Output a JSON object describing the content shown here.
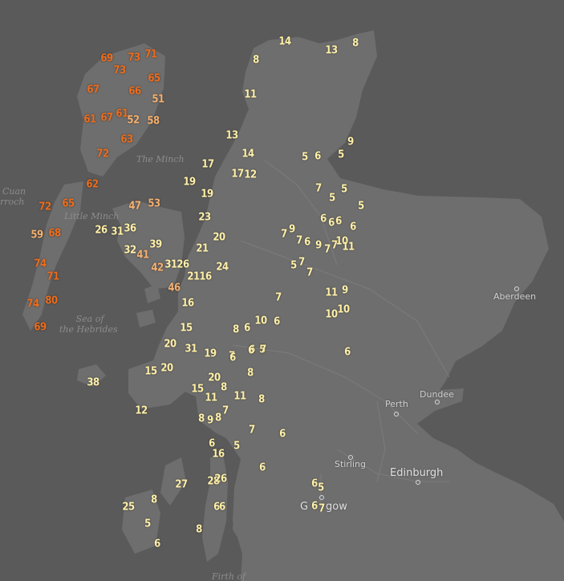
{
  "map": {
    "colors": {
      "sea": "#5a5a5a",
      "land": "#6e6e6e",
      "low": "#fff0a8",
      "mid": "#f5b070",
      "high": "#ee6c1c"
    },
    "water_labels": {
      "minch": "The Minch",
      "little_minch": "Little Minch",
      "sea_hebrides_1": "Sea of",
      "sea_hebrides_2": "the Hebrides",
      "cuan_1": "Cuan",
      "cuan_2": "rroch",
      "firth": "Firth of"
    },
    "places": {
      "aberdeen": "Aberdeen",
      "dundee": "Dundee",
      "perth": "Perth",
      "stirling": "Stirling",
      "edinburgh": "Edinburgh",
      "glasgow_1": "G",
      "glasgow_2": "gow"
    },
    "markers": [
      {
        "v": "14",
        "c": "low"
      },
      {
        "v": "8",
        "c": "low"
      },
      {
        "v": "13",
        "c": "low"
      },
      {
        "v": "8",
        "c": "low"
      },
      {
        "v": "11",
        "c": "low"
      },
      {
        "v": "73",
        "c": "high"
      },
      {
        "v": "71",
        "c": "high"
      },
      {
        "v": "69",
        "c": "high"
      },
      {
        "v": "73",
        "c": "high"
      },
      {
        "v": "67",
        "c": "high"
      },
      {
        "v": "65",
        "c": "high"
      },
      {
        "v": "66",
        "c": "high"
      },
      {
        "v": "51",
        "c": "mid"
      },
      {
        "v": "61",
        "c": "high"
      },
      {
        "v": "67",
        "c": "high"
      },
      {
        "v": "61",
        "c": "high"
      },
      {
        "v": "52",
        "c": "mid"
      },
      {
        "v": "58",
        "c": "mid"
      },
      {
        "v": "63",
        "c": "high"
      },
      {
        "v": "72",
        "c": "high"
      },
      {
        "v": "62",
        "c": "high"
      },
      {
        "v": "72",
        "c": "high"
      },
      {
        "v": "65",
        "c": "high"
      },
      {
        "v": "59",
        "c": "mid"
      },
      {
        "v": "68",
        "c": "high"
      },
      {
        "v": "74",
        "c": "high"
      },
      {
        "v": "71",
        "c": "high"
      },
      {
        "v": "74",
        "c": "high"
      },
      {
        "v": "80",
        "c": "high"
      },
      {
        "v": "69",
        "c": "high"
      },
      {
        "v": "13",
        "c": "low"
      },
      {
        "v": "14",
        "c": "low"
      },
      {
        "v": "17",
        "c": "low"
      },
      {
        "v": "17",
        "c": "low"
      },
      {
        "v": "12",
        "c": "low"
      },
      {
        "v": "19",
        "c": "low"
      },
      {
        "v": "19",
        "c": "low"
      },
      {
        "v": "47",
        "c": "mid"
      },
      {
        "v": "53",
        "c": "mid"
      },
      {
        "v": "23",
        "c": "low"
      },
      {
        "v": "26",
        "c": "low"
      },
      {
        "v": "31",
        "c": "low"
      },
      {
        "v": "36",
        "c": "low"
      },
      {
        "v": "20",
        "c": "low"
      },
      {
        "v": "32",
        "c": "low"
      },
      {
        "v": "41",
        "c": "mid"
      },
      {
        "v": "39",
        "c": "low"
      },
      {
        "v": "21",
        "c": "low"
      },
      {
        "v": "42",
        "c": "mid"
      },
      {
        "v": "31",
        "c": "low"
      },
      {
        "v": "26",
        "c": "low"
      },
      {
        "v": "24",
        "c": "low"
      },
      {
        "v": "21",
        "c": "low"
      },
      {
        "v": "16",
        "c": "low"
      },
      {
        "v": "46",
        "c": "mid"
      },
      {
        "v": "16",
        "c": "low"
      },
      {
        "v": "15",
        "c": "low"
      },
      {
        "v": "20",
        "c": "low"
      },
      {
        "v": "31",
        "c": "low"
      },
      {
        "v": "19",
        "c": "low"
      },
      {
        "v": "15",
        "c": "low"
      },
      {
        "v": "20",
        "c": "low"
      },
      {
        "v": "38",
        "c": "low"
      },
      {
        "v": "20",
        "c": "low"
      },
      {
        "v": "15",
        "c": "low"
      },
      {
        "v": "11",
        "c": "low"
      },
      {
        "v": "12",
        "c": "low"
      },
      {
        "v": "8",
        "c": "low"
      },
      {
        "v": "9",
        "c": "low"
      },
      {
        "v": "8",
        "c": "low"
      },
      {
        "v": "7",
        "c": "low"
      },
      {
        "v": "8",
        "c": "low"
      },
      {
        "v": "11",
        "c": "low"
      },
      {
        "v": "8",
        "c": "low"
      },
      {
        "v": "6",
        "c": "low"
      },
      {
        "v": "5",
        "c": "low"
      },
      {
        "v": "7",
        "c": "low"
      },
      {
        "v": "7",
        "c": "low"
      },
      {
        "v": "6",
        "c": "low"
      },
      {
        "v": "6",
        "c": "low"
      },
      {
        "v": "16",
        "c": "low"
      },
      {
        "v": "5",
        "c": "low"
      },
      {
        "v": "6",
        "c": "low"
      },
      {
        "v": "27",
        "c": "low"
      },
      {
        "v": "28",
        "c": "low"
      },
      {
        "v": "26",
        "c": "low"
      },
      {
        "v": "25",
        "c": "low"
      },
      {
        "v": "8",
        "c": "low"
      },
      {
        "v": "5",
        "c": "low"
      },
      {
        "v": "6",
        "c": "low"
      },
      {
        "v": "6",
        "c": "low"
      },
      {
        "v": "6",
        "c": "low"
      },
      {
        "v": "8",
        "c": "low"
      },
      {
        "v": "6",
        "c": "low"
      },
      {
        "v": "5",
        "c": "low"
      },
      {
        "v": "6",
        "c": "low"
      },
      {
        "v": "7",
        "c": "low"
      },
      {
        "v": "5",
        "c": "low"
      },
      {
        "v": "6",
        "c": "low"
      },
      {
        "v": "5",
        "c": "low"
      },
      {
        "v": "9",
        "c": "low"
      },
      {
        "v": "7",
        "c": "low"
      },
      {
        "v": "5",
        "c": "low"
      },
      {
        "v": "5",
        "c": "low"
      },
      {
        "v": "5",
        "c": "low"
      },
      {
        "v": "6",
        "c": "low"
      },
      {
        "v": "6",
        "c": "low"
      },
      {
        "v": "6",
        "c": "low"
      },
      {
        "v": "6",
        "c": "low"
      },
      {
        "v": "7",
        "c": "low"
      },
      {
        "v": "9",
        "c": "low"
      },
      {
        "v": "7",
        "c": "low"
      },
      {
        "v": "6",
        "c": "low"
      },
      {
        "v": "9",
        "c": "low"
      },
      {
        "v": "7",
        "c": "low"
      },
      {
        "v": "7",
        "c": "low"
      },
      {
        "v": "10",
        "c": "low"
      },
      {
        "v": "11",
        "c": "low"
      },
      {
        "v": "5",
        "c": "low"
      },
      {
        "v": "7",
        "c": "low"
      },
      {
        "v": "7",
        "c": "low"
      },
      {
        "v": "11",
        "c": "low"
      },
      {
        "v": "9",
        "c": "low"
      },
      {
        "v": "10",
        "c": "low"
      },
      {
        "v": "10",
        "c": "low"
      },
      {
        "v": "7",
        "c": "low"
      },
      {
        "v": "8",
        "c": "low"
      },
      {
        "v": "6",
        "c": "low"
      },
      {
        "v": "10",
        "c": "low"
      },
      {
        "v": "6",
        "c": "low"
      },
      {
        "v": "6",
        "c": "low"
      },
      {
        "v": "6",
        "c": "low"
      },
      {
        "v": "7",
        "c": "low"
      },
      {
        "v": "8",
        "c": "low"
      },
      {
        "v": "6",
        "c": "low"
      }
    ]
  }
}
